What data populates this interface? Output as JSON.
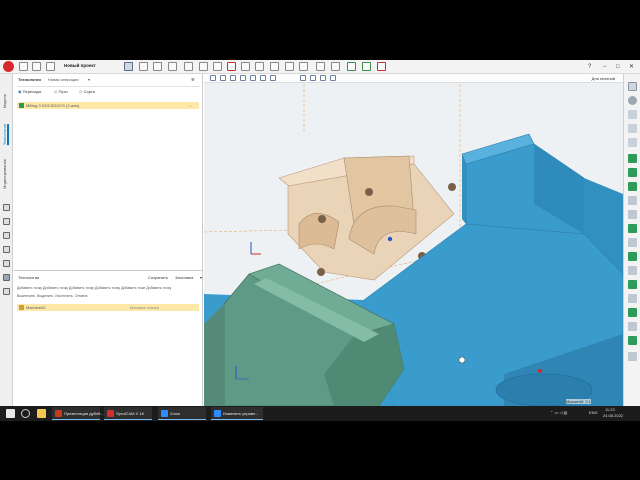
{
  "topbar": {
    "title": "Новый проект",
    "help": "?",
    "min": "−",
    "restore": "□",
    "close": "✕"
  },
  "rail": {
    "tabs": [
      "Модель",
      "Технология",
      "Моделирование"
    ]
  },
  "panel": {
    "header": "Технология",
    "new_op": "Новая операция",
    "actions": [
      "Переходы",
      "Пути",
      "Сорта"
    ],
    "op_item": "Milling 3 DOCSDOCS (2-axis)",
    "lower_header": "Технологии",
    "lower_save": "Сохранить",
    "lower_cancel": "Заготовка",
    "lower_tools": [
      "Добавить точку",
      "Добавить точку",
      "Добавить точку",
      "Добавить точку",
      "Добавить тоже",
      "Добавить точку"
    ],
    "lower_tools2": [
      "Выключить",
      "Выделить",
      "Исключить",
      "Отмена"
    ],
    "lower_item": "Machine02",
    "lower_item_extra": "Машина станка"
  },
  "viewport": {
    "view_mode": "Для сечений",
    "scale": "Масштаб: 2:1"
  },
  "taskbar": {
    "items": [
      {
        "label": "Презентация дублё...",
        "color": "#c43b1b"
      },
      {
        "label": "SprutCAM X 16",
        "color": "#d32f2f"
      },
      {
        "label": "Zoom",
        "color": "#2d8cff"
      },
      {
        "label": "Изменить управл...",
        "color": "#2d8cff"
      }
    ],
    "lang": "ENG",
    "time": "11:23",
    "date": "24.08.2022"
  },
  "colors": {
    "accent": "#0a77b5",
    "part_blue": "#3a9ccc",
    "jaw_green": "#5f9a86",
    "stock_tan": "#ead4b8"
  }
}
